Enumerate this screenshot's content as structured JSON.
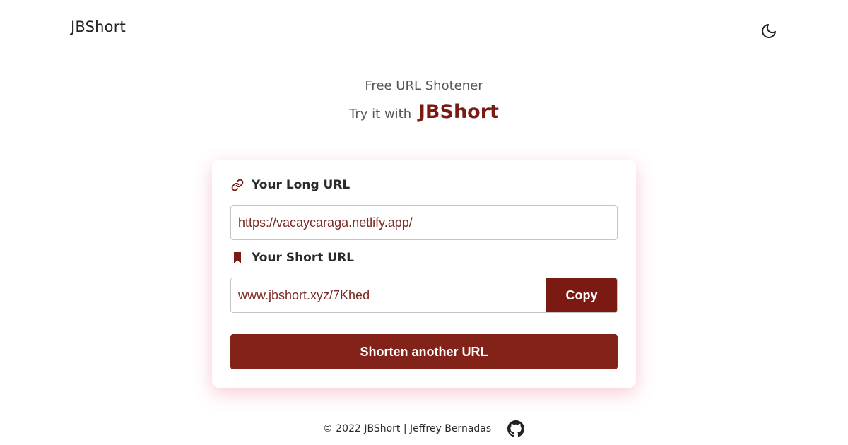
{
  "header": {
    "brand": "JBShort",
    "theme_toggle_icon": "moon-icon"
  },
  "hero": {
    "subtitle": "Free URL Shotener",
    "tagline_prefix": "Try it with",
    "tagline_brand": "JBShort"
  },
  "form": {
    "long_url": {
      "label": "Your Long URL",
      "icon": "link-icon",
      "value": "https://vacaycaraga.netlify.app/"
    },
    "short_url": {
      "label": "Your Short URL",
      "icon": "bookmark-icon",
      "value": "www.jbshort.xyz/7Khed",
      "copy_label": "Copy"
    },
    "shorten_again_label": "Shorten another URL"
  },
  "footer": {
    "text": "© 2022 JBShort | Jeffrey Bernadas",
    "github_icon": "github-icon"
  },
  "colors": {
    "accent": "#7a1a13",
    "button": "#832218",
    "card_glow": "#e76e82"
  }
}
